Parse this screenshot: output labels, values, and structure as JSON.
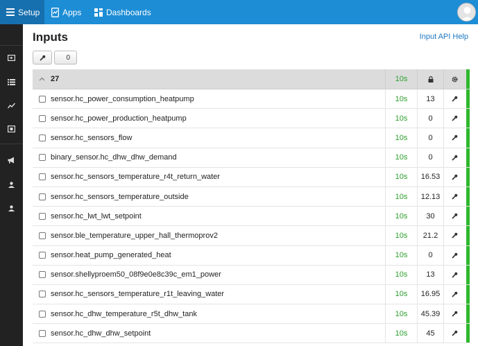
{
  "nav": {
    "setup_label": "Setup",
    "apps_label": "Apps",
    "dashboards_label": "Dashboards"
  },
  "sidebar": {
    "items": [
      "inputs-icon",
      "feeds-icon",
      "graphs-icon",
      "visualization-icon",
      "announce-icon",
      "user-icon",
      "admin-user-icon"
    ]
  },
  "page": {
    "title": "Inputs",
    "help_link": "Input API Help",
    "selected_count": "0"
  },
  "group": {
    "label": "27",
    "time": "10s"
  },
  "colors": {
    "accent": "#1d8dd5",
    "time_text": "#2ca02c",
    "status": "#2eb82e"
  },
  "inputs": [
    {
      "name": "sensor.hc_power_consumption_heatpump",
      "time": "10s",
      "value": "13"
    },
    {
      "name": "sensor.hc_power_production_heatpump",
      "time": "10s",
      "value": "0"
    },
    {
      "name": "sensor.hc_sensors_flow",
      "time": "10s",
      "value": "0"
    },
    {
      "name": "binary_sensor.hc_dhw_dhw_demand",
      "time": "10s",
      "value": "0"
    },
    {
      "name": "sensor.hc_sensors_temperature_r4t_return_water",
      "time": "10s",
      "value": "16.53"
    },
    {
      "name": "sensor.hc_sensors_temperature_outside",
      "time": "10s",
      "value": "12.13"
    },
    {
      "name": "sensor.hc_lwt_lwt_setpoint",
      "time": "10s",
      "value": "30"
    },
    {
      "name": "sensor.ble_temperature_upper_hall_thermoprov2",
      "time": "10s",
      "value": "21.2"
    },
    {
      "name": "sensor.heat_pump_generated_heat",
      "time": "10s",
      "value": "0"
    },
    {
      "name": "sensor.shellyproem50_08f9e0e8c39c_em1_power",
      "time": "10s",
      "value": "13"
    },
    {
      "name": "sensor.hc_sensors_temperature_r1t_leaving_water",
      "time": "10s",
      "value": "16.95"
    },
    {
      "name": "sensor.hc_dhw_temperature_r5t_dhw_tank",
      "time": "10s",
      "value": "45.39"
    },
    {
      "name": "sensor.hc_dhw_dhw_setpoint",
      "time": "10s",
      "value": "45"
    }
  ]
}
